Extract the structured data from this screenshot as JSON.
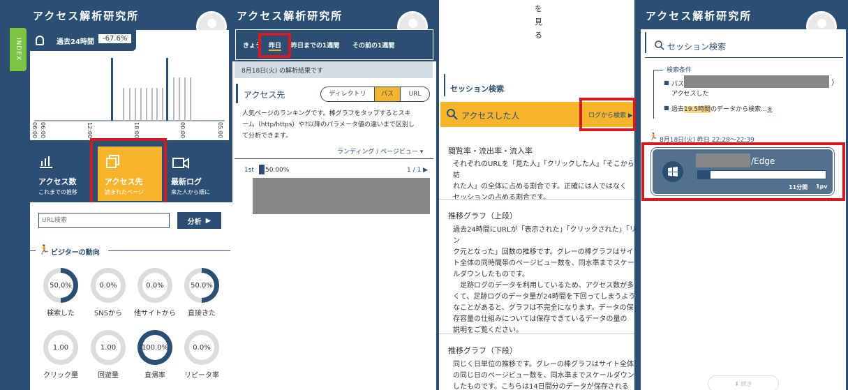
{
  "logo": "アクセス解析研究所",
  "p1": {
    "index_tab": "INDEX",
    "stat_label": "過去24時間",
    "stat_value": "-67.6%",
    "axis_ticks": [
      "06:00",
      "06:00",
      "12:00",
      "18:00",
      "00:00",
      "05:00"
    ],
    "tiles": [
      {
        "title": "アクセス数",
        "sub": "これまでの推移"
      },
      {
        "title": "アクセス先",
        "sub": "読まれたページ"
      },
      {
        "title": "最新ログ",
        "sub": "来た人から順に"
      }
    ],
    "url_placeholder": "URL検索",
    "analyze_button": "分析",
    "visitor_heading": "ビジターの動向",
    "donuts": [
      {
        "value": "50.0%",
        "label": "検索した",
        "pct": 0.5
      },
      {
        "value": "0.0%",
        "label": "SNSから",
        "pct": 0
      },
      {
        "value": "0.0%",
        "label": "他サイトから",
        "pct": 0
      },
      {
        "value": "50.0%",
        "label": "直接きた",
        "pct": 0.5
      },
      {
        "value": "1.00",
        "label": "クリック量",
        "pct": 0
      },
      {
        "value": "1.00",
        "label": "回遊量",
        "pct": 0
      },
      {
        "value": "100.0%",
        "label": "直帰率",
        "pct": 1
      },
      {
        "value": "0.0%",
        "label": "リピータ率",
        "pct": 0
      }
    ],
    "colors": {
      "navy": "#2b4f72",
      "accent": "#f6b42c",
      "gray": "#b9b9b9"
    }
  },
  "p2": {
    "tabs": [
      "きょう",
      "昨日",
      "昨日までの1週間",
      "その前の1週間"
    ],
    "date_banner": "8月18日(火) の解析結果です",
    "section_title": "アクセス先",
    "seg": [
      "ディレクトリ",
      "パス",
      "URL"
    ],
    "desc": [
      "人気ページのランキングです。棒グラフをタップするとスキ",
      "ーム（http/https）や?以降のパラメータ値の違いまで区別し",
      "て分析できます。"
    ],
    "dropdown": "ランディング / ページビュー",
    "rank": "1st",
    "rank_pct": "50.00%",
    "pager": "1 / 1"
  },
  "p3": {
    "top_chars": [
      "を",
      "見",
      "る"
    ],
    "title": "セッション検索",
    "bar_label": "アクセスした人",
    "bar_link": "ログから検索",
    "h1": "閲覧率・流出率・流入率",
    "p1": [
      "それぞれのURLを「見た人」「クリックした人」「そこから訪",
      "れた人」の全体に占める割合です。正確には人ではなく",
      "セッションの占める割合です。"
    ],
    "h2": "推移グラフ（上段）",
    "p2": [
      "過去24時間にURLが「表示された」「クリックされた」「リン",
      "ク元となった」回数の推移です。グレーの棒グラフはサイ",
      "ト全体の同時間帯のページビュー数を、同水準までスケー",
      "ルダウンしたものです。",
      "　足跡ログのデータを利用しているため、アクセス数が多",
      "くて、足跡ログのデータ量が24時間を下回ってしまうよう",
      "なことがあると、グラフは不完全になります。データの保",
      "存容量の仕組みについては保存できているデータの量の",
      "説明をご覧ください。"
    ],
    "h3": "推移グラフ（下段）",
    "p3": [
      "同じく日単位の推移です。グレーの棒グラフはサイト全体",
      "の同じ日のページビュー数を、同水準までスケールダウン",
      "したものです。こちらは14日間分のデータが保存される"
    ]
  },
  "p4": {
    "title": "セッション検索",
    "cond_label": "検索条件",
    "cond1": "パス",
    "cond1b": "アクセスした",
    "cond2_pre": "過去",
    "cond2_hl": "19.5時間",
    "cond2_post": "のデータから検索…",
    "cond2_link": "※",
    "time": "8月18日(火) 昨日 22:28～22:39",
    "browser": "/Edge",
    "duration": "11分間",
    "pv": "1pv",
    "more": "続き"
  }
}
